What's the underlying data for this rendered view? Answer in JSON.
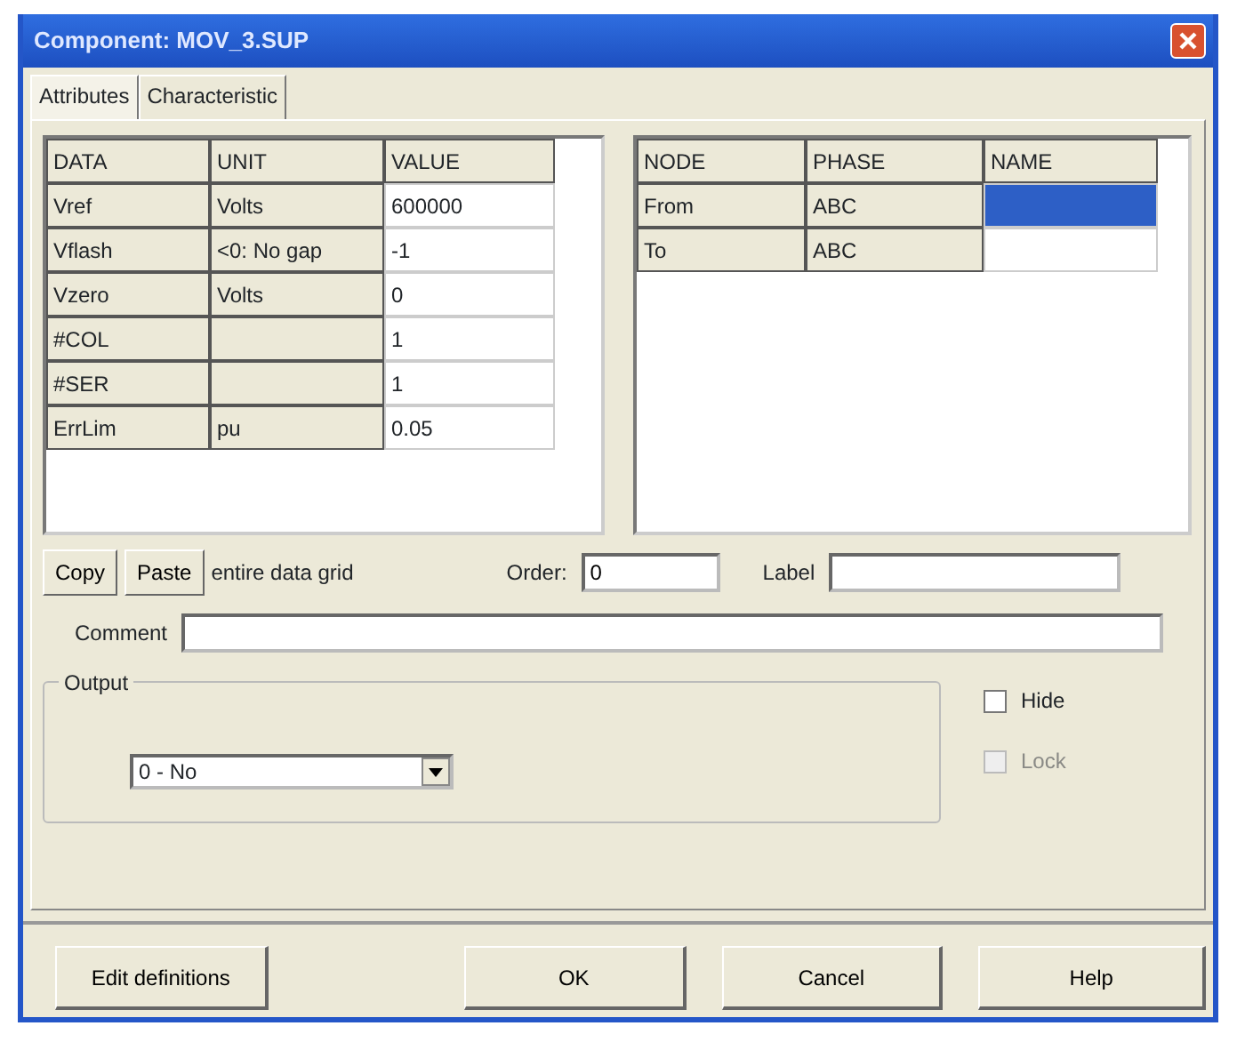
{
  "window": {
    "title": "Component: MOV_3.SUP"
  },
  "tabs": [
    {
      "label": "Attributes",
      "selected": true
    },
    {
      "label": "Characteristic",
      "selected": false
    }
  ],
  "data_grid": {
    "columns": [
      "DATA",
      "UNIT",
      "VALUE"
    ],
    "rows": [
      {
        "data": "Vref",
        "unit": "Volts",
        "value": "600000"
      },
      {
        "data": "Vflash",
        "unit": "<0: No gap",
        "value": "-1"
      },
      {
        "data": "Vzero",
        "unit": "Volts",
        "value": "0"
      },
      {
        "data": "#COL",
        "unit": "",
        "value": "1"
      },
      {
        "data": "#SER",
        "unit": "",
        "value": "1"
      },
      {
        "data": "ErrLim",
        "unit": "pu",
        "value": "0.05"
      }
    ]
  },
  "node_grid": {
    "columns": [
      "NODE",
      "PHASE",
      "NAME"
    ],
    "rows": [
      {
        "node": "From",
        "phase": "ABC",
        "selected": true
      },
      {
        "node": "To",
        "phase": "ABC",
        "selected": false
      }
    ]
  },
  "copy_button": "Copy",
  "paste_button": "Paste",
  "grid_note": "entire data grid",
  "order": {
    "label": "Order:",
    "value": "0"
  },
  "label_field": {
    "label": "Label"
  },
  "comment": {
    "label": "Comment"
  },
  "output": {
    "legend": "Output",
    "value": "0 - No"
  },
  "checkboxes": [
    {
      "label": "Hide",
      "checked": false,
      "disabled": false
    },
    {
      "label": "Lock",
      "checked": false,
      "disabled": true
    }
  ],
  "buttons": [
    "Edit definitions",
    "OK",
    "Cancel",
    "Help"
  ]
}
